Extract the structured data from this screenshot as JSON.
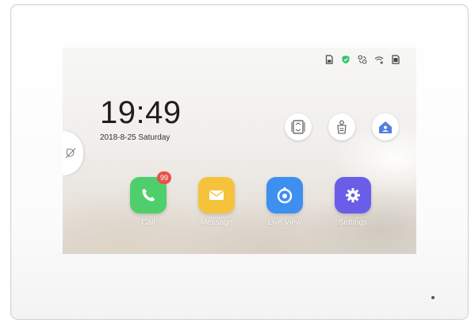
{
  "status_bar": {
    "icons": [
      "sd-card-icon",
      "shield-icon",
      "link-broken-icon",
      "wifi-off-icon",
      "sim-card-icon"
    ],
    "shield_color": "#2fc46b"
  },
  "home": {
    "time": "19:49",
    "date": "2018-8-25  Saturday"
  },
  "side_tab": {
    "icon": "no-disturb-icon"
  },
  "quick_actions": [
    {
      "name": "door-unlock-icon"
    },
    {
      "name": "elevator-call-icon"
    },
    {
      "name": "home-arm-icon",
      "color": "#4f7fe0"
    }
  ],
  "apps": [
    {
      "label": "Call",
      "icon": "phone-icon",
      "color": "#4fcf6c",
      "badge": "99"
    },
    {
      "label": "Message",
      "icon": "envelope-icon",
      "color": "#f5c23b"
    },
    {
      "label": "Live View",
      "icon": "camera-icon",
      "color": "#3d8ff0"
    },
    {
      "label": "Settings",
      "icon": "gear-icon",
      "color": "#6a5ee8"
    }
  ]
}
